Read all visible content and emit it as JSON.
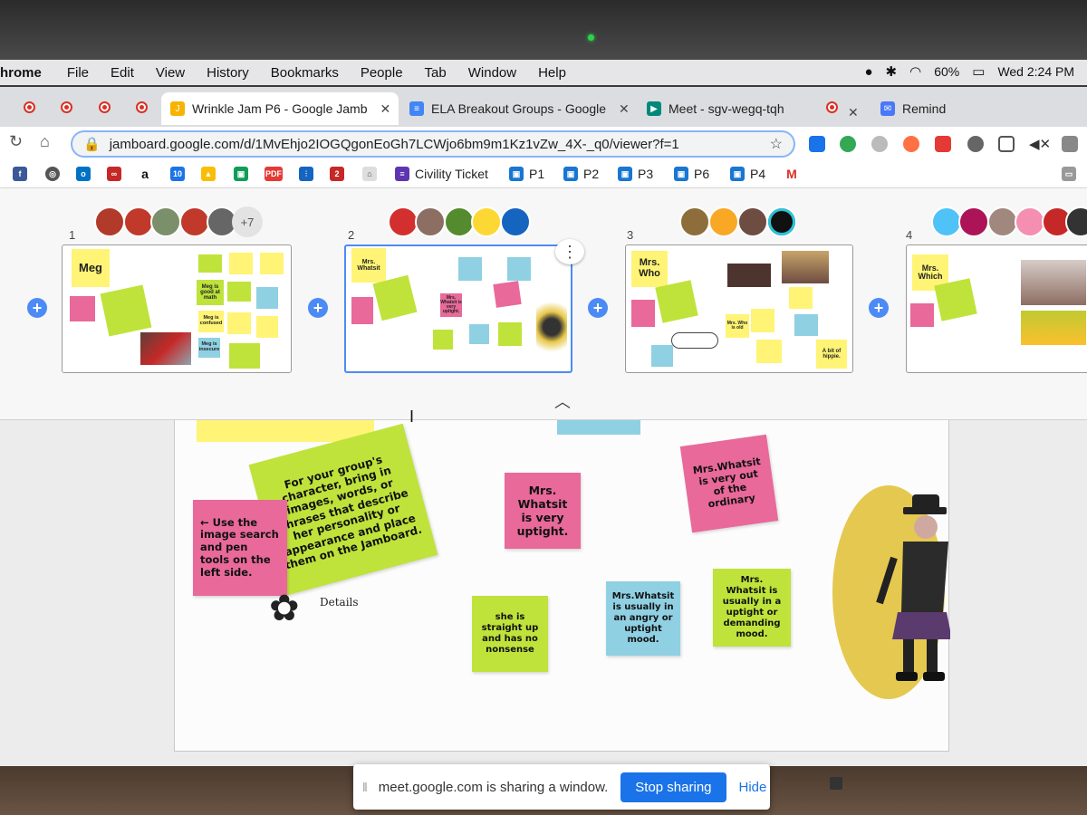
{
  "menubar": {
    "app": "hrome",
    "items": [
      "File",
      "Edit",
      "View",
      "History",
      "Bookmarks",
      "People",
      "Tab",
      "Window",
      "Help"
    ],
    "battery": "60%",
    "clock": "Wed 2:24 PM"
  },
  "tabs": [
    {
      "label": "Wrinkle Jam P6 - Google Jamb",
      "icon": "jamboard-icon",
      "color": "#f6b400",
      "active": true
    },
    {
      "label": "ELA Breakout Groups - Google",
      "icon": "docs-icon",
      "color": "#4285f4"
    },
    {
      "label": "Meet - sgv-wegq-tqh",
      "icon": "meet-icon",
      "color": "#00897b"
    },
    {
      "label": "Remind",
      "icon": "remind-icon",
      "color": "#4a79f7"
    }
  ],
  "address": {
    "url": "jamboard.google.com/d/1MvEhjo2IOGQgonEoGh7LCWjo6bm9m1Kz1vZw_4X-_q0/viewer?f=1"
  },
  "bookmarks": {
    "calendar_num": "10",
    "pdf": "PDF",
    "two": "2",
    "items": [
      "Civility Ticket",
      "P1",
      "P2",
      "P3",
      "P6",
      "P4"
    ]
  },
  "frames": {
    "nums": [
      "1",
      "2",
      "3",
      "4"
    ],
    "more_count": "+7",
    "f1": {
      "title": "Meg",
      "notes": [
        "Meg is good at math",
        "Meg is confused",
        "Meg is insecure"
      ]
    },
    "f2": {
      "title": "Mrs. Whatsit",
      "notes": [
        "Mrs. Whatsit is very uptight."
      ]
    },
    "f3": {
      "title": "Mrs. Who",
      "notes": [
        "Mrs. Who is old",
        "A bit of hippie."
      ]
    },
    "f4": {
      "title": "Mrs. Which"
    }
  },
  "board": {
    "instructions": "For your group's character, bring in images, words, or phrases that describe her personality or appearance and place them on the Jamboard.",
    "tools_hint": "← Use the image search and pen tools on the left side.",
    "details": "Details",
    "notes": [
      "Mrs. Whatsit is very uptight.",
      "Mrs.Whatsit is very out of the ordinary",
      "she is straight up and has no nonsense",
      "Mrs.Whatsit is usually in an angry or uptight mood.",
      "Mrs. Whatsit is usually in a uptight or demanding mood."
    ]
  },
  "sharebar": {
    "message": "meet.google.com is sharing a window.",
    "stop": "Stop sharing",
    "hide": "Hide"
  },
  "colors": {
    "yellow": "#fff475",
    "pink": "#e8699a",
    "green": "#bfe33b",
    "blue": "#8fd0e3",
    "accent": "#4c8bf5"
  }
}
